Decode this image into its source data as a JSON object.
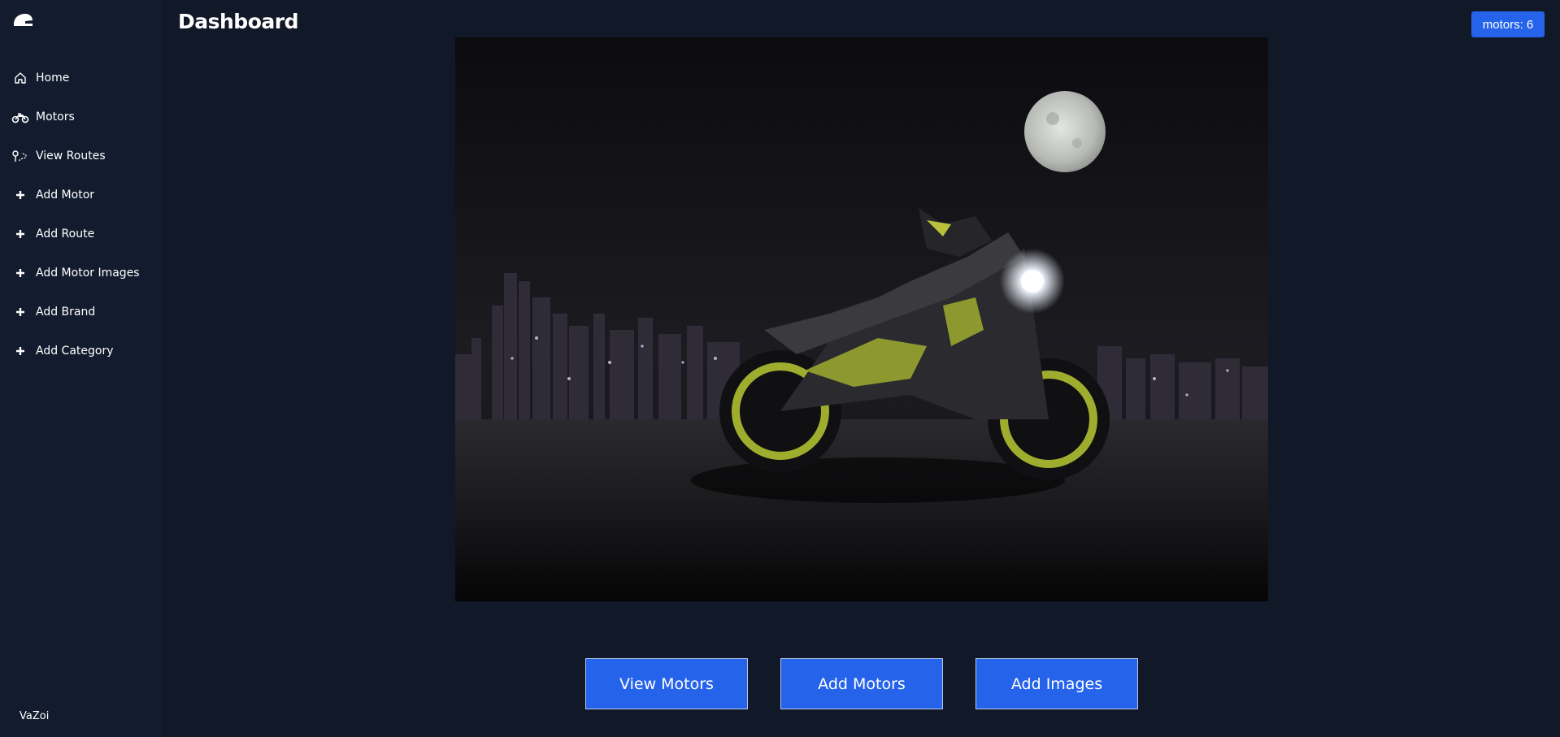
{
  "header": {
    "title": "Dashboard",
    "motor_count_badge": "motors: 6"
  },
  "sidebar": {
    "logo_icon": "helmet-icon",
    "items": [
      {
        "label": "Home",
        "icon": "home-icon"
      },
      {
        "label": "Motors",
        "icon": "motorcycle-icon"
      },
      {
        "label": "View Routes",
        "icon": "route-icon"
      },
      {
        "label": "Add Motor",
        "icon": "plus-icon"
      },
      {
        "label": "Add Route",
        "icon": "plus-icon"
      },
      {
        "label": "Add Motor Images",
        "icon": "plus-icon"
      },
      {
        "label": "Add Brand",
        "icon": "plus-icon"
      },
      {
        "label": "Add Category",
        "icon": "plus-icon"
      }
    ],
    "footer": "VaZoi"
  },
  "main": {
    "hero_image": "motorcycle-at-night-photo",
    "actions": [
      {
        "label": "View Motors"
      },
      {
        "label": "Add Motors"
      },
      {
        "label": "Add Images"
      }
    ]
  },
  "colors": {
    "background": "#111827",
    "sidebar": "#131c2e",
    "accent": "#2563eb",
    "text": "#ffffff"
  }
}
